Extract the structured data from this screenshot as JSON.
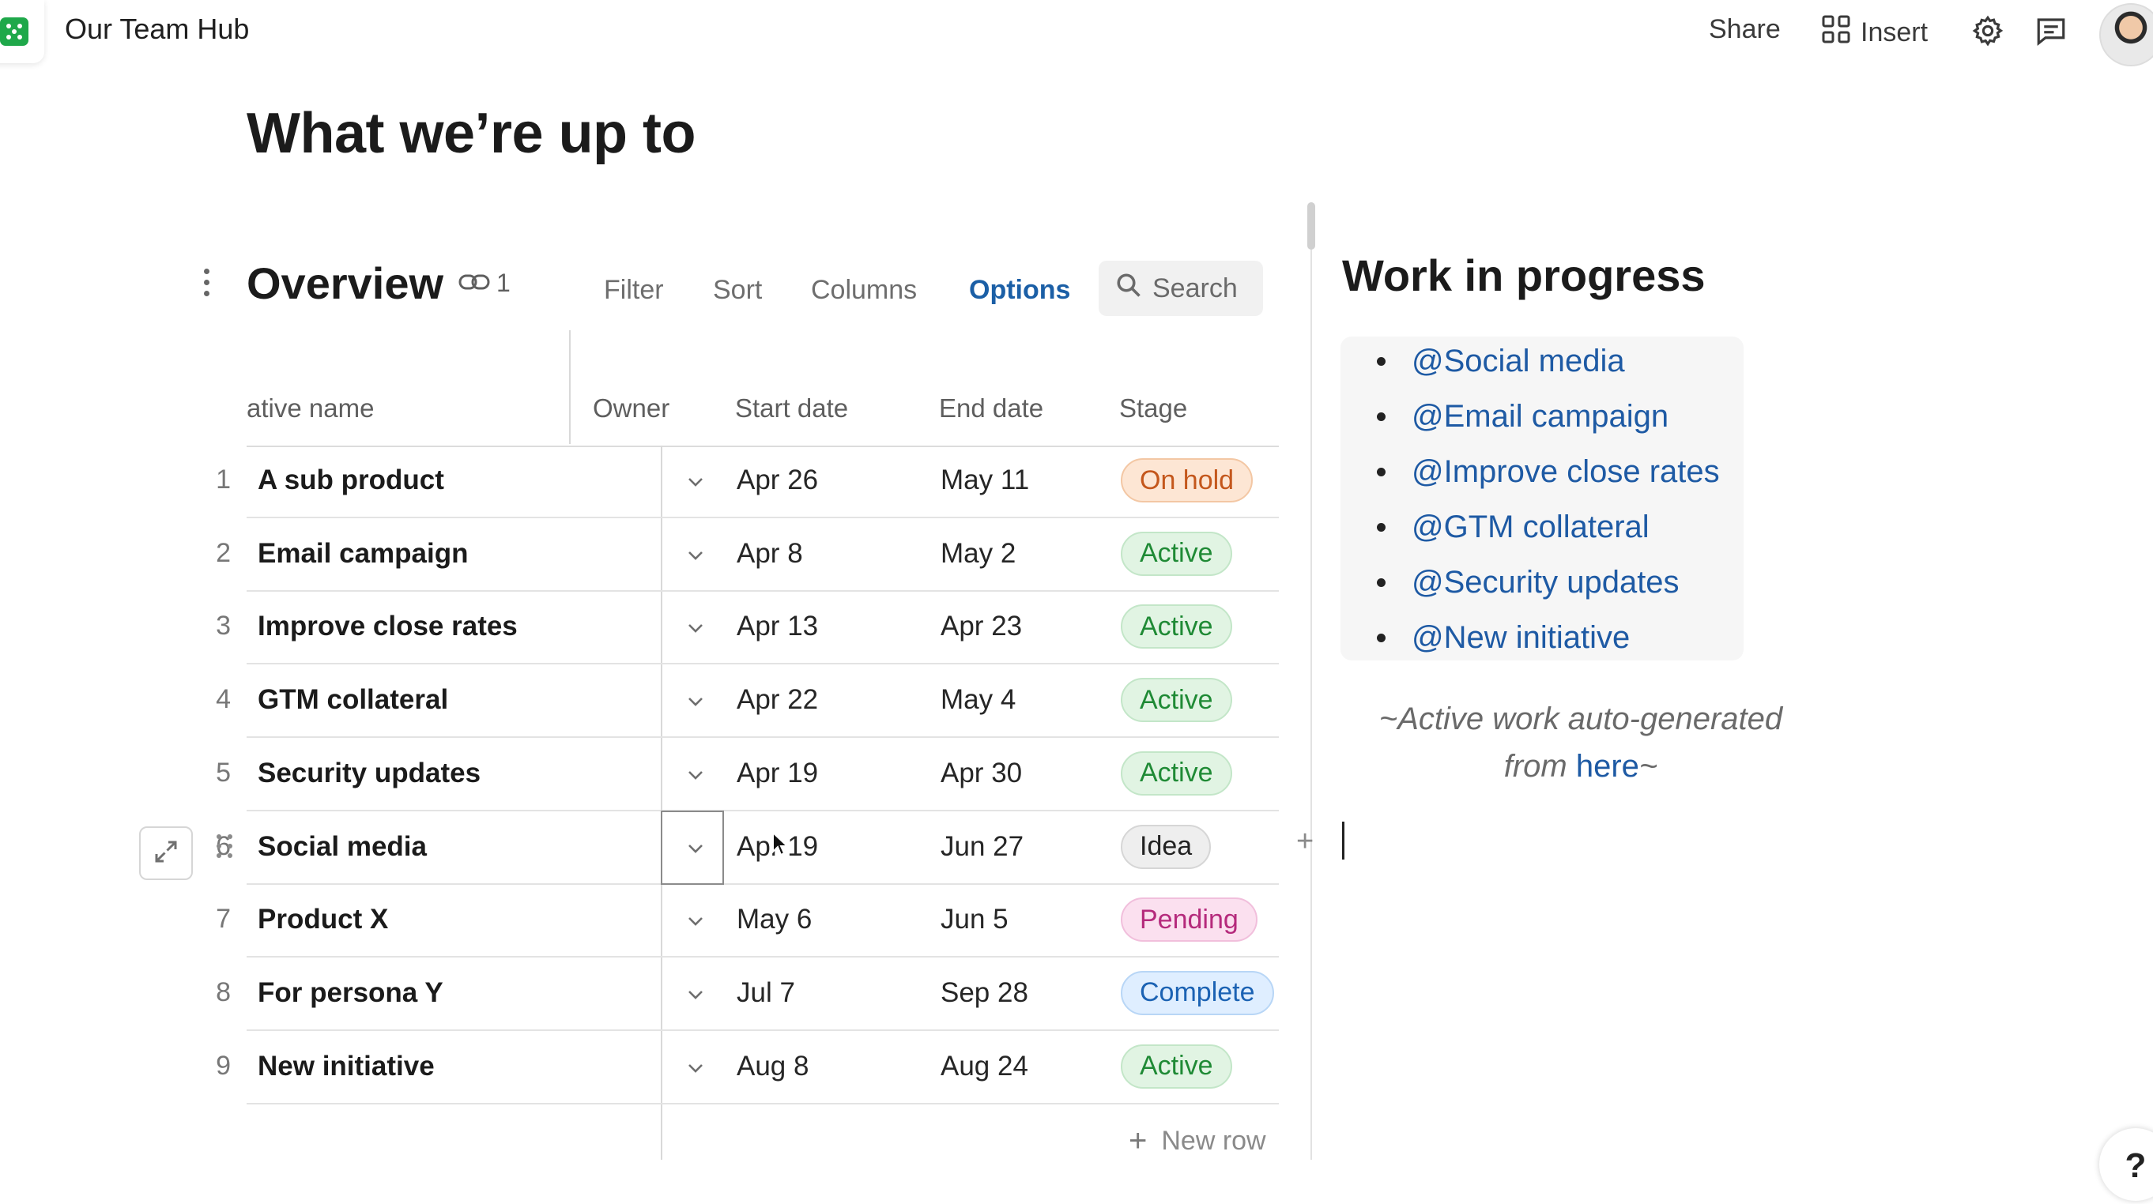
{
  "header": {
    "doc_title": "Our Team Hub",
    "share_label": "Share",
    "insert_label": "Insert"
  },
  "page": {
    "title": "What we’re up to"
  },
  "table": {
    "title": "Overview",
    "link_count": "1",
    "toolbar": {
      "filter": "Filter",
      "sort": "Sort",
      "columns": "Columns",
      "options": "Options",
      "search_placeholder": "Search"
    },
    "columns": [
      "ative name",
      "Owner",
      "Start date",
      "End date",
      "Stage"
    ],
    "rows": [
      {
        "num": "1",
        "name": "A sub product",
        "start": "Apr 26",
        "end": "May 11",
        "stage": "On hold"
      },
      {
        "num": "2",
        "name": "Email campaign",
        "start": "Apr 8",
        "end": "May 2",
        "stage": "Active"
      },
      {
        "num": "3",
        "name": "Improve close rates",
        "start": "Apr 13",
        "end": "Apr 23",
        "stage": "Active"
      },
      {
        "num": "4",
        "name": "GTM collateral",
        "start": "Apr 22",
        "end": "May 4",
        "stage": "Active"
      },
      {
        "num": "5",
        "name": "Security updates",
        "start": "Apr 19",
        "end": "Apr 30",
        "stage": "Active"
      },
      {
        "num": "6",
        "name": "Social media",
        "start": "Apr 19",
        "end": "Jun 27",
        "stage": "Idea"
      },
      {
        "num": "7",
        "name": "Product X",
        "start": "May 6",
        "end": "Jun 5",
        "stage": "Pending"
      },
      {
        "num": "8",
        "name": "For persona Y",
        "start": "Jul 7",
        "end": "Sep 28",
        "stage": "Complete"
      },
      {
        "num": "9",
        "name": "New initiative",
        "start": "Aug 8",
        "end": "Aug 24",
        "stage": "Active"
      }
    ],
    "new_row_label": "New row"
  },
  "wip": {
    "title": "Work in progress",
    "items": [
      "@Social media",
      "@Email campaign",
      "@Improve close rates",
      "@GTM collateral",
      "@Security updates",
      "@New initiative"
    ],
    "note_prefix": "~Active work auto-generated from ",
    "note_link": "here",
    "note_suffix": "~"
  },
  "help_label": "?",
  "colors": {
    "link_blue": "#1e5aa4",
    "options_blue": "#1b5fa6",
    "brand_green": "#1fa84a"
  }
}
